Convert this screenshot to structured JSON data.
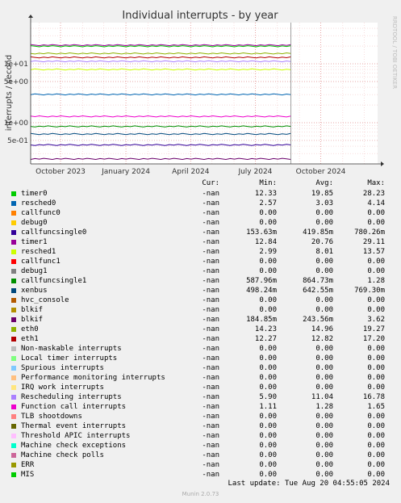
{
  "chart_data": {
    "type": "line",
    "title": "Individual interrupts - by year",
    "ylabel": "interrupts / second",
    "watermark": "RRDTOOL / TOBI OETIKER",
    "y_scale": "log",
    "ylim": [
      0.2,
      50
    ],
    "y_major_ticks": [
      {
        "value": 10,
        "label": "1e+01"
      },
      {
        "value": 5,
        "label": "5e+00"
      },
      {
        "value": 1,
        "label": "1e+00"
      },
      {
        "value": 0.5,
        "label": "5e-01"
      }
    ],
    "x_ticks": [
      "October 2023",
      "January 2024",
      "April 2024",
      "July 2024",
      "October 2024"
    ],
    "x_range": [
      "2023-08-20",
      "2024-12-20"
    ],
    "x_tick_dates": [
      "2023-10-01",
      "2024-01-01",
      "2024-04-01",
      "2024-07-01",
      "2024-10-01"
    ],
    "now_marker": "2024-08-20",
    "grid": true,
    "columns": {
      "cur": "Cur:",
      "min": "Min:",
      "avg": "Avg:",
      "max": "Max:"
    },
    "series": [
      {
        "name": "timer0",
        "color": "#00cc00",
        "cur": "-nan",
        "min": "12.33",
        "avg": "19.85",
        "max": "28.23",
        "plot": 19.85
      },
      {
        "name": "resched0",
        "color": "#0066b3",
        "cur": "-nan",
        "min": "2.57",
        "avg": "3.03",
        "max": "4.14",
        "plot": 3.03
      },
      {
        "name": "callfunc0",
        "color": "#ff8000",
        "cur": "-nan",
        "min": "0.00",
        "avg": "0.00",
        "max": "0.00"
      },
      {
        "name": "debug0",
        "color": "#ffcc00",
        "cur": "-nan",
        "min": "0.00",
        "avg": "0.00",
        "max": "0.00"
      },
      {
        "name": "callfuncsingle0",
        "color": "#330099",
        "cur": "-nan",
        "min": "153.63m",
        "avg": "419.85m",
        "max": "780.26m",
        "plot": 0.41985
      },
      {
        "name": "timer1",
        "color": "#990099",
        "cur": "-nan",
        "min": "12.84",
        "avg": "20.76",
        "max": "29.11",
        "plot": 20.76
      },
      {
        "name": "resched1",
        "color": "#ccff00",
        "cur": "-nan",
        "min": "2.99",
        "avg": "8.01",
        "max": "13.57",
        "plot": 8.01
      },
      {
        "name": "callfunc1",
        "color": "#ff0000",
        "cur": "-nan",
        "min": "0.00",
        "avg": "0.00",
        "max": "0.00"
      },
      {
        "name": "debug1",
        "color": "#808080",
        "cur": "-nan",
        "min": "0.00",
        "avg": "0.00",
        "max": "0.00"
      },
      {
        "name": "callfuncsingle1",
        "color": "#008f00",
        "cur": "-nan",
        "min": "587.96m",
        "avg": "864.73m",
        "max": "1.28",
        "plot": 0.86473
      },
      {
        "name": "xenbus",
        "color": "#00487d",
        "cur": "-nan",
        "min": "498.24m",
        "avg": "642.55m",
        "max": "769.30m",
        "plot": 0.64255
      },
      {
        "name": "hvc_console",
        "color": "#b35a00",
        "cur": "-nan",
        "min": "0.00",
        "avg": "0.00",
        "max": "0.00"
      },
      {
        "name": "blkif",
        "color": "#b38f00",
        "cur": "-nan",
        "min": "0.00",
        "avg": "0.00",
        "max": "0.00"
      },
      {
        "name": "blkif",
        "color": "#6b006b",
        "cur": "-nan",
        "min": "184.85m",
        "avg": "243.56m",
        "max": "3.62",
        "plot": 0.24356
      },
      {
        "name": "eth0",
        "color": "#8fb300",
        "cur": "-nan",
        "min": "14.23",
        "avg": "14.96",
        "max": "19.27",
        "plot": 14.96
      },
      {
        "name": "eth1",
        "color": "#b30000",
        "cur": "-nan",
        "min": "12.27",
        "avg": "12.82",
        "max": "17.20",
        "plot": 12.82
      },
      {
        "name": "Non-maskable interrupts",
        "color": "#bebebe",
        "cur": "-nan",
        "min": "0.00",
        "avg": "0.00",
        "max": "0.00"
      },
      {
        "name": "Local timer interrupts",
        "color": "#80ff80",
        "cur": "-nan",
        "min": "0.00",
        "avg": "0.00",
        "max": "0.00"
      },
      {
        "name": "Spurious interrupts",
        "color": "#80c9ff",
        "cur": "-nan",
        "min": "0.00",
        "avg": "0.00",
        "max": "0.00"
      },
      {
        "name": "Performance monitoring interrupts",
        "color": "#ffc080",
        "cur": "-nan",
        "min": "0.00",
        "avg": "0.00",
        "max": "0.00"
      },
      {
        "name": "IRQ work interrupts",
        "color": "#ffe680",
        "cur": "-nan",
        "min": "0.00",
        "avg": "0.00",
        "max": "0.00"
      },
      {
        "name": "Rescheduling interrupts",
        "color": "#aa80ff",
        "cur": "-nan",
        "min": "5.90",
        "avg": "11.04",
        "max": "16.78",
        "plot": 11.04
      },
      {
        "name": "Function call interrupts",
        "color": "#ee00cc",
        "cur": "-nan",
        "min": "1.11",
        "avg": "1.28",
        "max": "1.65",
        "plot": 1.28
      },
      {
        "name": "TLB shootdowns",
        "color": "#ff8080",
        "cur": "-nan",
        "min": "0.00",
        "avg": "0.00",
        "max": "0.00"
      },
      {
        "name": "Thermal event interrupts",
        "color": "#666600",
        "cur": "-nan",
        "min": "0.00",
        "avg": "0.00",
        "max": "0.00"
      },
      {
        "name": "Threshold APIC interrupts",
        "color": "#ffbfff",
        "cur": "-nan",
        "min": "0.00",
        "avg": "0.00",
        "max": "0.00"
      },
      {
        "name": "Machine check exceptions",
        "color": "#00ffcc",
        "cur": "-nan",
        "min": "0.00",
        "avg": "0.00",
        "max": "0.00"
      },
      {
        "name": "Machine check polls",
        "color": "#cc6699",
        "cur": "-nan",
        "min": "0.00",
        "avg": "0.00",
        "max": "0.00"
      },
      {
        "name": "ERR",
        "color": "#999900",
        "cur": "-nan",
        "min": "0.00",
        "avg": "0.00",
        "max": "0.00"
      },
      {
        "name": "MIS",
        "color": "#00cc00",
        "cur": "-nan",
        "min": "0.00",
        "avg": "0.00",
        "max": "0.00"
      }
    ]
  },
  "footer": {
    "last_update": "Last update: Tue Aug 20 04:55:05 2024",
    "munin": "Munin 2.0.73"
  }
}
